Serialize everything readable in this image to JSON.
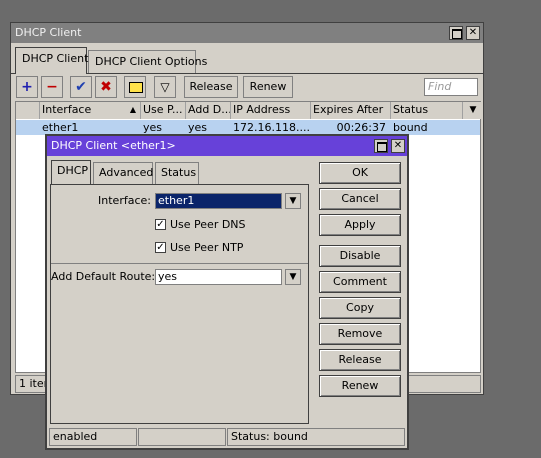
{
  "outer": {
    "title": "DHCP Client",
    "tabs": [
      "DHCP Client",
      "DHCP Client Options"
    ],
    "toolbar": {
      "release_label": "Release",
      "renew_label": "Renew",
      "find_placeholder": "Find"
    },
    "table": {
      "columns": [
        "Interface",
        "Use P...",
        "Add D...",
        "IP Address",
        "Expires After",
        "Status"
      ],
      "rows": [
        {
          "interface": "ether1",
          "use_peer": "yes",
          "add_default": "yes",
          "ip": "172.16.118....",
          "expires": "00:26:37",
          "status": "bound"
        }
      ]
    },
    "status_count": "1 item"
  },
  "dialog": {
    "title": "DHCP Client <ether1>",
    "tabs": [
      "DHCP",
      "Advanced",
      "Status"
    ],
    "interface_label": "Interface:",
    "interface_value": "ether1",
    "use_peer_dns_label": "Use Peer DNS",
    "use_peer_ntp_label": "Use Peer NTP",
    "add_default_route_label": "Add Default Route:",
    "add_default_route_value": "yes",
    "buttons": {
      "ok": "OK",
      "cancel": "Cancel",
      "apply": "Apply",
      "disable": "Disable",
      "comment": "Comment",
      "copy": "Copy",
      "remove": "Remove",
      "release": "Release",
      "renew": "Renew"
    },
    "status_bar": {
      "enabled": "enabled",
      "middle": "",
      "status": "Status: bound"
    }
  },
  "colors": {
    "accent_title_active": "#6741d9",
    "title_inactive": "#808080",
    "selected_row": "#b8d2f0"
  }
}
